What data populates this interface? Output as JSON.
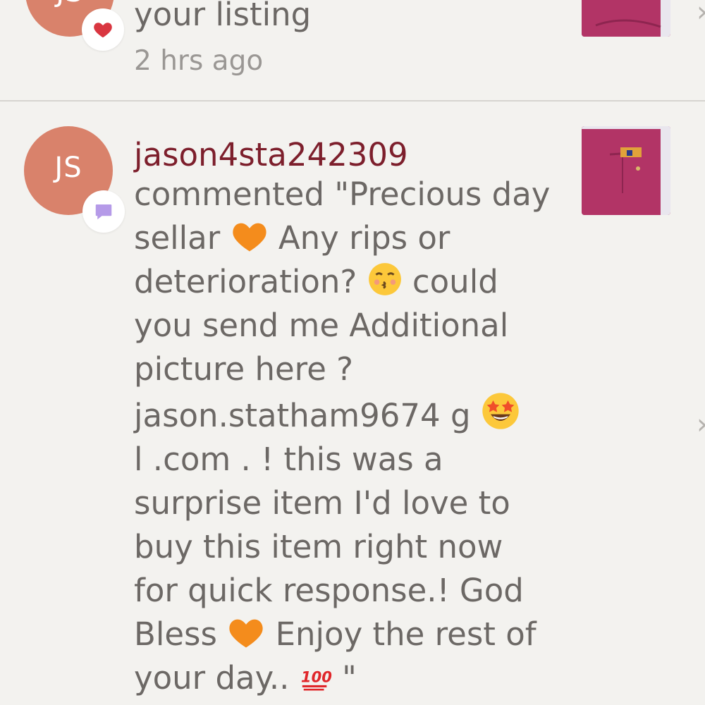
{
  "notifications": [
    {
      "avatar_initials": "JS",
      "badge_icon": "heart-icon",
      "text": "your listing",
      "time": "2 hrs ago",
      "thumb_color": "#b23466"
    },
    {
      "avatar_initials": "JS",
      "badge_icon": "comment-icon",
      "username": "jason4sta242309",
      "comment_lines": [
        "commented \"Precious day",
        "sellar",
        "Any rips or",
        "deterioration?",
        "could",
        "you send me Additional",
        "picture here ?",
        "jason.statham9674 g",
        "l .com . ! this was a",
        "surprise item I'd love to",
        "buy this item right now",
        "for quick response.! God",
        "Bless",
        "Enjoy the rest of",
        "your day..",
        "\""
      ],
      "thumb_color": "#b23466"
    }
  ],
  "colors": {
    "background": "#f3f2ef",
    "avatar": "#d9826b",
    "username": "#7d1f2c",
    "body_text": "#6c6865",
    "heart": "#d93640",
    "comment_badge": "#b59ae8"
  },
  "emoji": {
    "heart": "orange-heart-emoji",
    "kiss": "kissing-face-emoji",
    "star_eyes": "star-struck-emoji",
    "hundred": "hundred-points-emoji"
  }
}
